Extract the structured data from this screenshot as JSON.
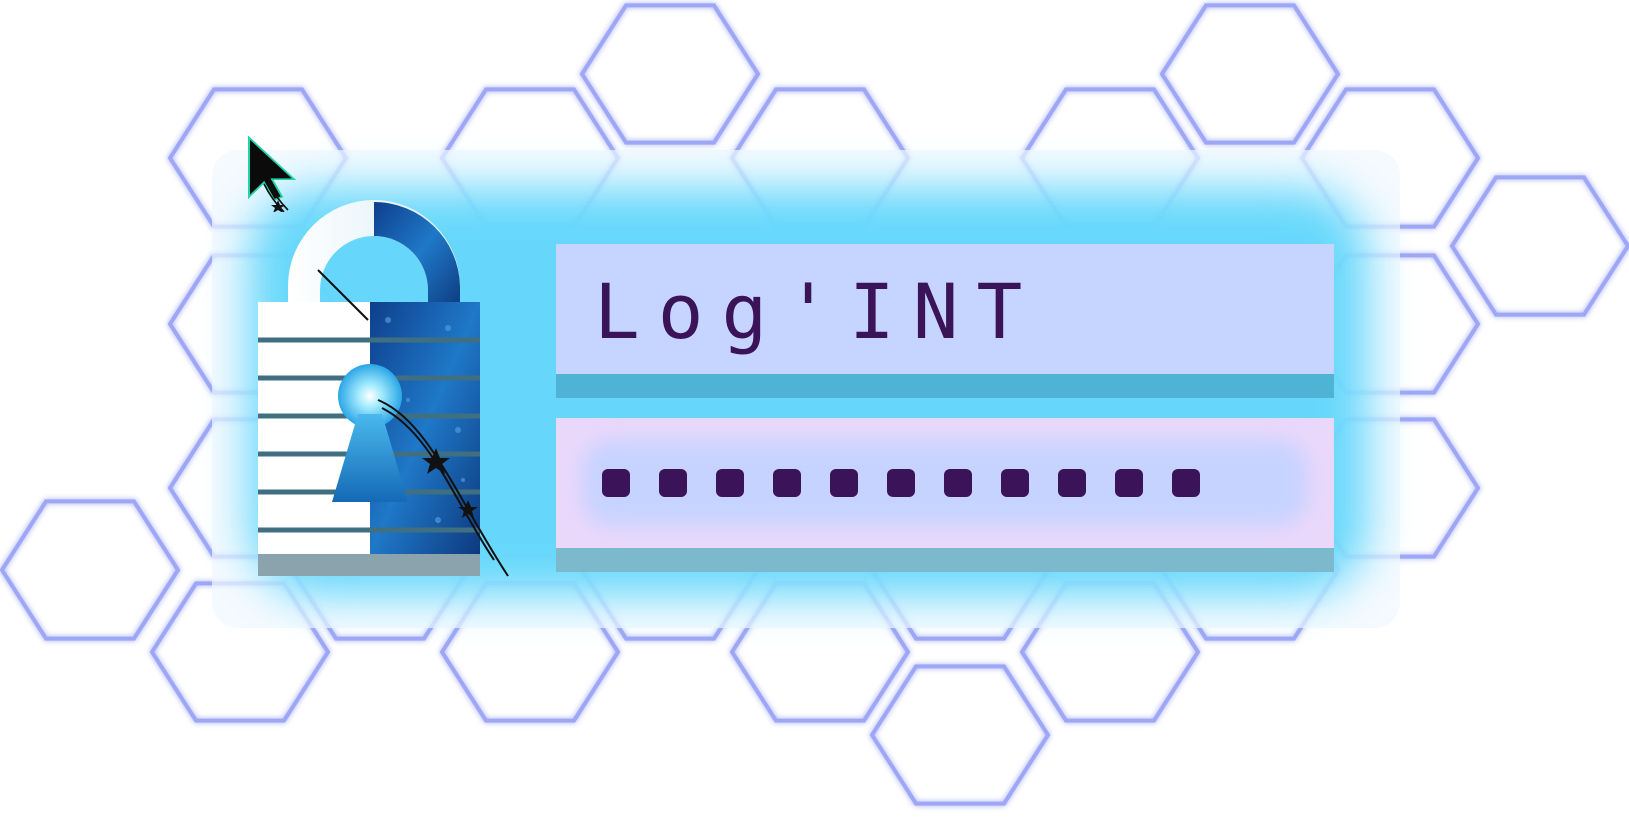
{
  "app": {
    "title": "Log'INT"
  },
  "login": {
    "username_value": "Log'INT",
    "password_mask_count": 11,
    "password_mask_char": "■"
  },
  "icons": {
    "lock": "padlock-keyhole-icon",
    "cursor": "mouse-pointer-icon",
    "background": "hexagon-pattern"
  },
  "colors": {
    "background": "#ffffff",
    "hex_stroke": "#8d98f4",
    "panel": "#f0f8ff",
    "glow": "#5fd6fb",
    "username_field": "#c5d5ff",
    "password_field": "#ead8fb",
    "text": "#3a1358",
    "lock_blue": "#1b5fb0",
    "cursor_outline": "#21d4a6"
  }
}
